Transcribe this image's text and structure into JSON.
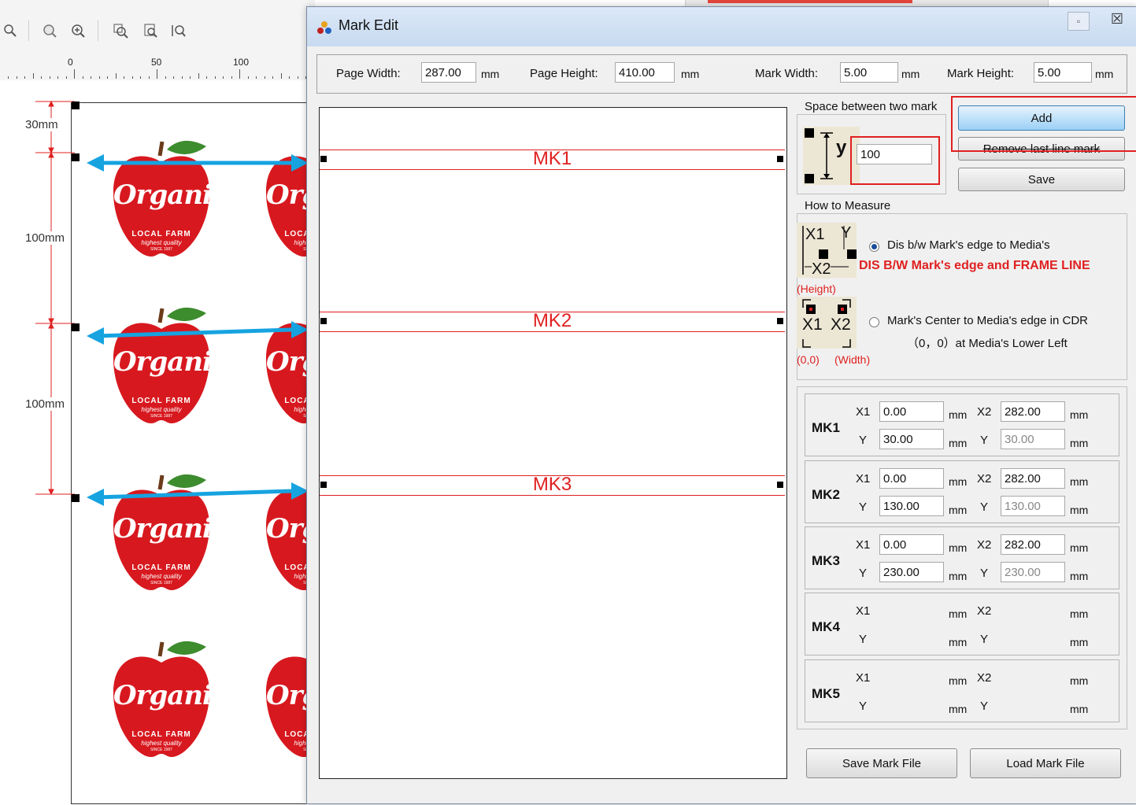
{
  "toolbar": {
    "icons": [
      "zoom-icon",
      "zoom-out-icon",
      "zoom-in-icon",
      "zoom-selected-icon",
      "zoom-page-icon",
      "zoom-width-icon"
    ]
  },
  "ruler": {
    "labels": [
      "0",
      "50",
      "100"
    ]
  },
  "canvas": {
    "dims": [
      "30mm",
      "100mm",
      "100mm"
    ],
    "apple": {
      "brand": "Organic",
      "line1": "LOCAL FARM",
      "line2": "highest quality",
      "line3": "SINCE 1987"
    }
  },
  "dialog": {
    "title": "Mark Edit",
    "close_glyph": "☒",
    "page_width_label": "Page Width:",
    "page_width": "287.00",
    "page_height_label": "Page Height:",
    "page_height": "410.00",
    "mark_width_label": "Mark Width:",
    "mark_width": "5.00",
    "mark_height_label": "Mark Height:",
    "mark_height": "5.00",
    "unit": "mm",
    "preview_marks": [
      "MK1",
      "MK2",
      "MK3"
    ],
    "space_group_title": "Space between two mark",
    "space_value": "100",
    "space_axis": "y",
    "add_label": "Add",
    "remove_label": "Remove last line mark",
    "save_label": "Save",
    "measure_group_title": "How to Measure",
    "measure_opt1": "Dis b/w Mark's edge to Media's",
    "measure_opt1_note": "DIS B/W Mark's edge and FRAME LINE",
    "measure_height_label": "(Height)",
    "measure_opt2": "Mark's Center to Media's edge in CDR",
    "measure_opt2_line2": "（0，0）at Media's Lower Left",
    "origin_label": "(0,0)",
    "width_label": "(Width)",
    "diagram_x1": "X1",
    "diagram_x2": "X2",
    "diagram_y": "Y",
    "marks": [
      {
        "name": "MK1",
        "x1": "0.00",
        "x2": "282.00",
        "y": "30.00",
        "y2": "30.00"
      },
      {
        "name": "MK2",
        "x1": "0.00",
        "x2": "282.00",
        "y": "130.00",
        "y2": "130.00"
      },
      {
        "name": "MK3",
        "x1": "0.00",
        "x2": "282.00",
        "y": "230.00",
        "y2": "230.00"
      },
      {
        "name": "MK4",
        "x1": "",
        "x2": "",
        "y": "",
        "y2": ""
      },
      {
        "name": "MK5",
        "x1": "",
        "x2": "",
        "y": "",
        "y2": ""
      }
    ],
    "x1_label": "X1",
    "x2_label": "X2",
    "y_label": "Y",
    "save_file_label": "Save Mark File",
    "load_file_label": "Load Mark File"
  },
  "colors": {
    "accent_red": "#e02020",
    "arrow_blue": "#16a3e0",
    "apple_red": "#d7191f",
    "leaf_green": "#3d8c2e"
  }
}
